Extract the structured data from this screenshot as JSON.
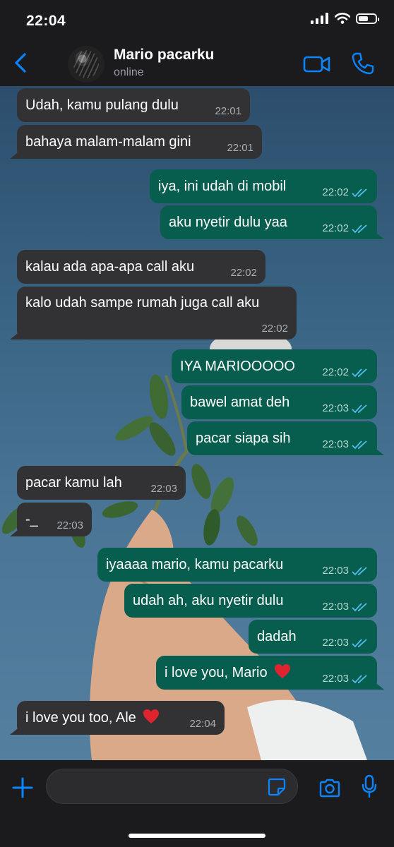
{
  "status_bar": {
    "time": "22:04"
  },
  "header": {
    "name": "Mario pacarku",
    "status": "online"
  },
  "colors": {
    "accent": "#0a84ff",
    "incoming_bubble": "#323234",
    "outgoing_bubble": "#075e4e",
    "read_check": "#53bdeb"
  },
  "messages": [
    {
      "dir": "in",
      "text": "Udah, kamu pulang dulu",
      "time": "22:01"
    },
    {
      "dir": "in",
      "text": "bahaya malam-malam gini",
      "time": "22:01"
    },
    {
      "dir": "out",
      "text": "iya, ini udah di mobil",
      "time": "22:02"
    },
    {
      "dir": "out",
      "text": "aku nyetir dulu yaa",
      "time": "22:02"
    },
    {
      "dir": "in",
      "text": "kalau ada apa-apa call aku",
      "time": "22:02"
    },
    {
      "dir": "in",
      "text": "kalo udah sampe rumah juga call aku",
      "time": "22:02"
    },
    {
      "dir": "out",
      "text": "IYA MARIOOOOO",
      "time": "22:02"
    },
    {
      "dir": "out",
      "text": "bawel amat deh",
      "time": "22:03"
    },
    {
      "dir": "out",
      "text": "pacar siapa sih",
      "time": "22:03"
    },
    {
      "dir": "in",
      "text": "pacar kamu lah",
      "time": "22:03"
    },
    {
      "dir": "in",
      "text": "-_",
      "time": "22:03"
    },
    {
      "dir": "out",
      "text": "iyaaaa mario, kamu pacarku",
      "time": "22:03"
    },
    {
      "dir": "out",
      "text": "udah ah, aku nyetir dulu",
      "time": "22:03"
    },
    {
      "dir": "out",
      "text": "dadah",
      "time": "22:03"
    },
    {
      "dir": "out",
      "text": "i love you, Mario",
      "time": "22:03",
      "emoji": "red-heart"
    },
    {
      "dir": "in",
      "text": "i love you too, Ale",
      "time": "22:04",
      "emoji": "red-heart"
    }
  ],
  "icons": {
    "back": "chevron-left-icon",
    "video": "video-camera-icon",
    "call": "phone-icon",
    "plus": "plus-icon",
    "sticker": "sticker-icon",
    "camera": "camera-icon",
    "mic": "microphone-icon"
  }
}
